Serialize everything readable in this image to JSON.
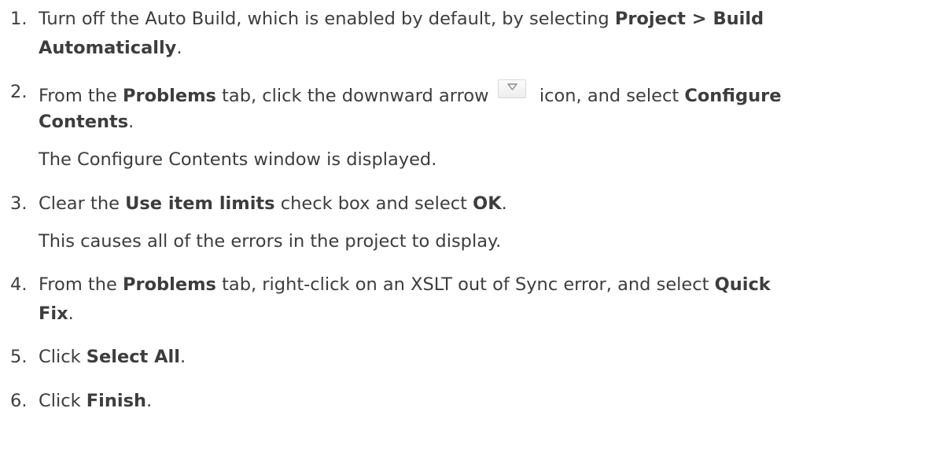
{
  "steps": [
    {
      "number": "1.",
      "lines": [
        {
          "a": "Turn off the Auto Build, which is enabled by default, by selecting ",
          "b": "Project > Build"
        },
        {
          "b": "Automatically",
          "a": "."
        }
      ]
    },
    {
      "number": "2.",
      "line1": {
        "a": "From the ",
        "b1": "Problems",
        "c": " tab, click the downward arrow ",
        "d": " icon, and select ",
        "b2": "Configure"
      },
      "line2": {
        "b": "Contents",
        "a": "."
      },
      "note": "The Configure Contents window is displayed.",
      "icon": "dropdown-arrow-icon"
    },
    {
      "number": "3.",
      "line": {
        "a": "Clear the ",
        "b1": "Use item limits",
        "c": " check box and select ",
        "b2": "OK",
        "d": "."
      },
      "note": "This causes all of the errors in the project to display."
    },
    {
      "number": "4.",
      "line1": {
        "a": "From the ",
        "b1": "Problems",
        "c": " tab, right-click on an XSLT out of Sync error, and select ",
        "b2": "Quick"
      },
      "line2": {
        "b": "Fix",
        "a": "."
      }
    },
    {
      "number": "5.",
      "line": {
        "a": "Click ",
        "b": "Select All",
        "c": "."
      }
    },
    {
      "number": "6.",
      "line": {
        "a": "Click ",
        "b": "Finish",
        "c": "."
      }
    }
  ],
  "colors": {
    "text": "#3d3d3d",
    "icon_arrow": "#8a8a8a"
  }
}
